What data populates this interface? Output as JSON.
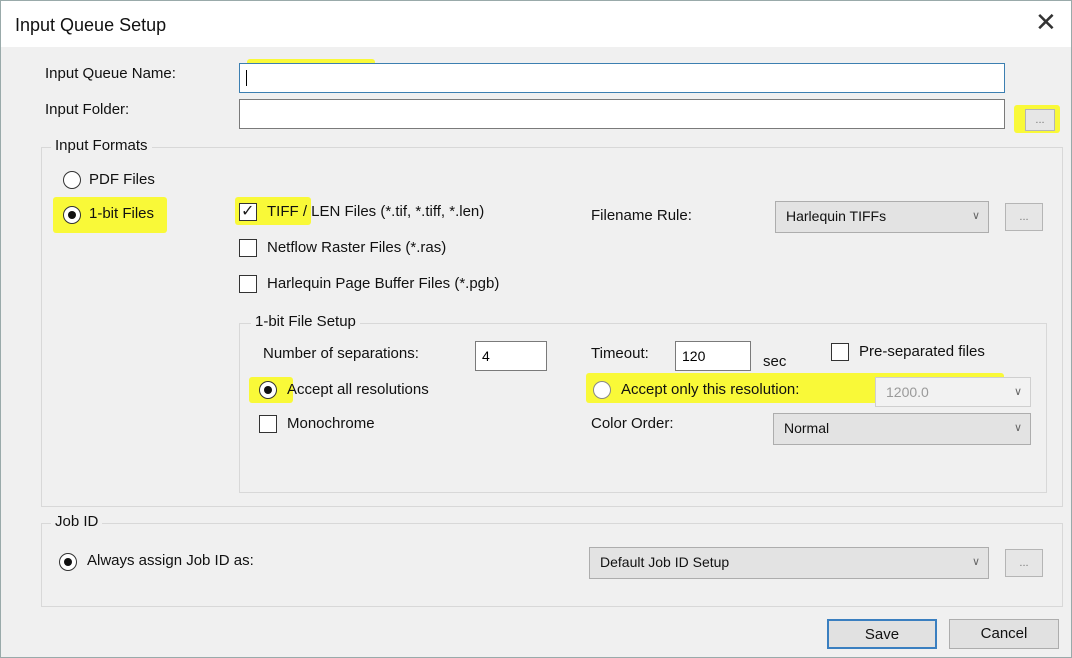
{
  "window": {
    "title": "Input Queue Setup",
    "close_glyph": "✕"
  },
  "fields": {
    "queue_name_label": "Input Queue Name:",
    "queue_name_value": "",
    "folder_label": "Input Folder:",
    "folder_value": "",
    "browse_label": "..."
  },
  "input_formats": {
    "legend": "Input Formats",
    "pdf_label": "PDF Files",
    "onebit_label": "1-bit Files",
    "selected": "1-bit Files",
    "tiff_highlight": "TIFF",
    "tiff_rest": " / LEN Files (*.tif, *.tiff, *.len)",
    "tiff_checked": true,
    "netflow_label": "Netflow Raster Files (*.ras)",
    "netflow_checked": false,
    "harlequin_label": "Harlequin Page Buffer Files (*.pgb)",
    "harlequin_checked": false,
    "filename_rule_label": "Filename Rule:",
    "filename_rule_value": "Harlequin TIFFs",
    "filename_rule_browse": "..."
  },
  "onebit_setup": {
    "legend": "1-bit File Setup",
    "separations_label": "Number of separations:",
    "separations_value": "4",
    "timeout_label": "Timeout:",
    "timeout_value": "120",
    "timeout_unit": "sec",
    "preseparated_label": "Pre-separated files",
    "preseparated_checked": false,
    "accept_all_label": "Accept all resolutions",
    "accept_only_label": "Accept only this resolution:",
    "resolution_mode": "Accept all resolutions",
    "resolution_value": "1200.0",
    "monochrome_label": "Monochrome",
    "monochrome_checked": false,
    "color_order_label": "Color Order:",
    "color_order_value": "Normal"
  },
  "job_id": {
    "legend": "Job ID",
    "always_assign_label": "Always assign Job ID as:",
    "setup_value": "Default Job ID Setup",
    "setup_browse": "..."
  },
  "buttons": {
    "save": "Save",
    "cancel": "Cancel"
  },
  "icons": {
    "dropdown": "chevron-down-icon",
    "close": "close-icon",
    "checkmark": "check-icon"
  },
  "colors": {
    "highlight": "#fafa18",
    "focus_border": "#3c7fb1",
    "dialog_bg": "#f0f0f0"
  }
}
